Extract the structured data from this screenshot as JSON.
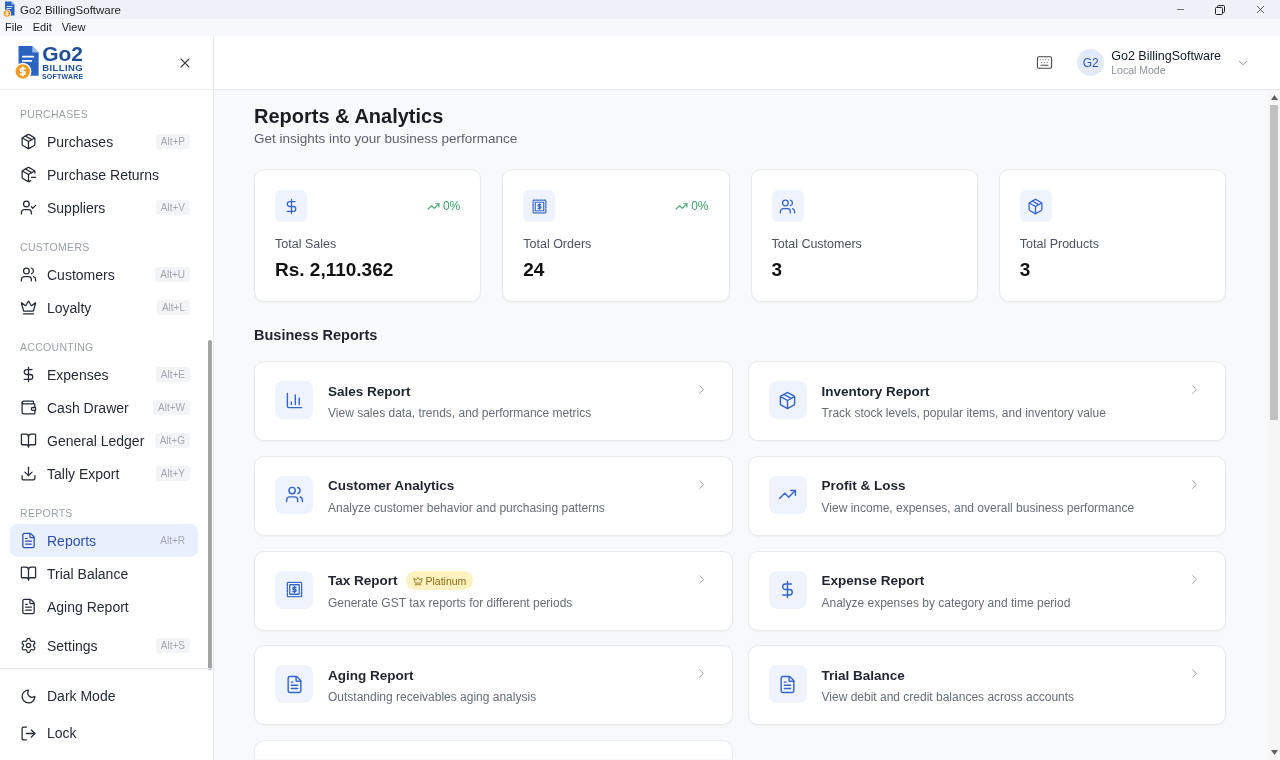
{
  "window": {
    "title": "Go2 BillingSoftware"
  },
  "menu_bar": [
    "File",
    "Edit",
    "View"
  ],
  "sidebar": {
    "logo": {
      "name": "Go2",
      "line_1": "BILLING",
      "line_2": "SOFTWARE"
    },
    "sections": [
      {
        "title": "PURCHASES",
        "items": [
          {
            "label": "Purchases",
            "shortcut": "Alt+P",
            "selected": false
          },
          {
            "label": "Purchase Returns",
            "selected": false
          },
          {
            "label": "Suppliers",
            "shortcut": "Alt+V",
            "selected": false
          }
        ]
      },
      {
        "title": "CUSTOMERS",
        "items": [
          {
            "label": "Customers",
            "shortcut": "Alt+U",
            "selected": false
          },
          {
            "label": "Loyalty",
            "shortcut": "Alt+L",
            "selected": false
          }
        ]
      },
      {
        "title": "ACCOUNTING",
        "items": [
          {
            "label": "Expenses",
            "shortcut": "Alt+E",
            "selected": false
          },
          {
            "label": "Cash Drawer",
            "shortcut": "Alt+W",
            "selected": false
          },
          {
            "label": "General Ledger",
            "shortcut": "Alt+G",
            "selected": false
          },
          {
            "label": "Tally Export",
            "shortcut": "Alt+Y",
            "selected": false
          }
        ]
      },
      {
        "title": "REPORTS",
        "items": [
          {
            "label": "Reports",
            "shortcut": "Alt+R",
            "selected": true
          },
          {
            "label": "Trial Balance",
            "selected": false
          },
          {
            "label": "Aging Report",
            "selected": false
          }
        ]
      },
      {
        "items": [
          {
            "label": "Settings",
            "shortcut": "Alt+S",
            "selected": false
          }
        ]
      }
    ],
    "footer_items": [
      "Dark Mode",
      "Lock"
    ]
  },
  "header": {
    "user": {
      "initials": "G2",
      "name": "Go2 BillingSoftware",
      "mode": "Local Mode"
    }
  },
  "page": {
    "title": "Reports & Analytics",
    "subtitle": "Get insights into your business performance"
  },
  "stats": [
    {
      "label": "Total Sales",
      "value": "Rs. 2,110.362",
      "trend": "0%"
    },
    {
      "label": "Total Orders",
      "value": "24",
      "trend": "0%"
    },
    {
      "label": "Total Customers",
      "value": "3"
    },
    {
      "label": "Total Products",
      "value": "3"
    }
  ],
  "business_reports": {
    "title": "Business Reports",
    "items": [
      {
        "title": "Sales Report",
        "description": "View sales data, trends, and performance metrics"
      },
      {
        "title": "Inventory Report",
        "description": "Track stock levels, popular items, and inventory value"
      },
      {
        "title": "Customer Analytics",
        "description": "Analyze customer behavior and purchasing patterns"
      },
      {
        "title": "Profit & Loss",
        "description": "View income, expenses, and overall business performance"
      },
      {
        "title": "Tax Report",
        "badge": "Platinum",
        "description": "Generate GST tax reports for different periods"
      },
      {
        "title": "Expense Report",
        "description": "Analyze expenses by category and time period"
      },
      {
        "title": "Aging Report",
        "description": "Outstanding receivables aging analysis"
      },
      {
        "title": "Trial Balance",
        "description": "View debit and credit balances across accounts"
      }
    ],
    "more_below": true
  }
}
